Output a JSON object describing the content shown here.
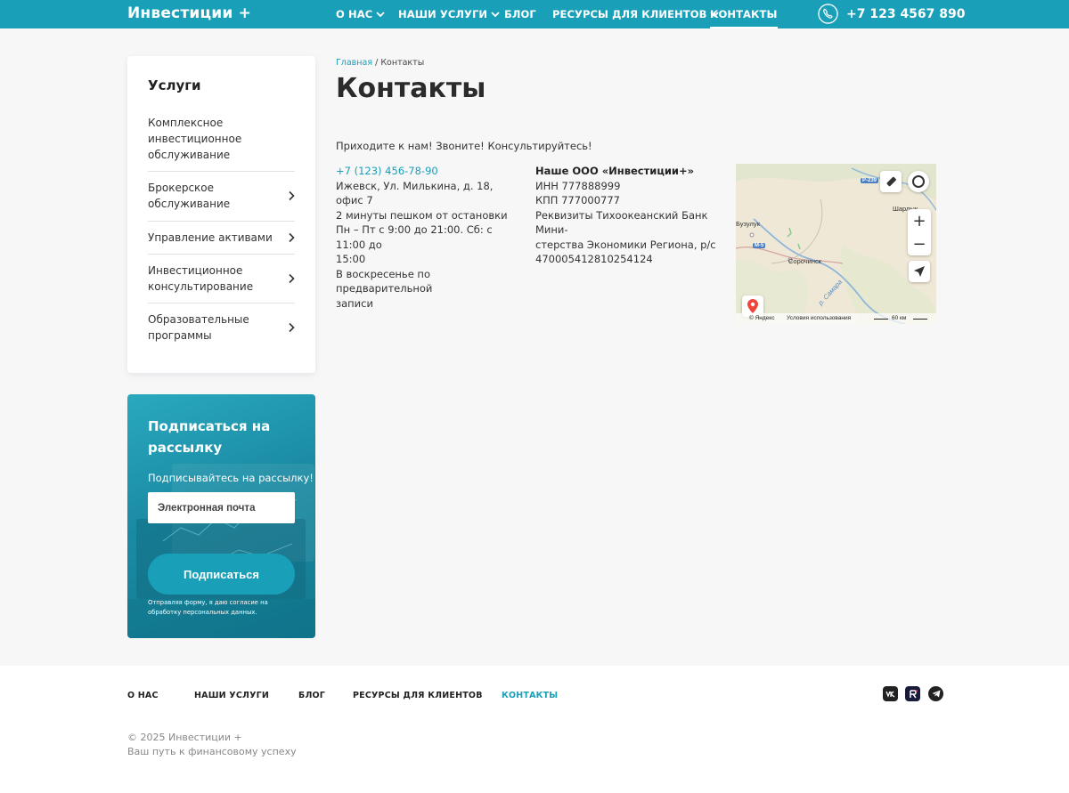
{
  "header": {
    "logo": "Инвестиции +",
    "nav": [
      {
        "label": "О НАС",
        "dropdown": true
      },
      {
        "label": "НАШИ УСЛУГИ",
        "dropdown": true
      },
      {
        "label": "БЛОГ",
        "dropdown": false
      },
      {
        "label": "РЕСУРСЫ ДЛЯ КЛИЕНТОВ",
        "dropdown": true
      },
      {
        "label": "КОНТАКТЫ",
        "dropdown": false,
        "active": true
      }
    ],
    "phone": "+7 123 4567 890",
    "phone_icon": "phone-icon"
  },
  "sidebar": {
    "title": "Услуги",
    "items": [
      {
        "line1": "Комплексное",
        "line2": "инвестиционное",
        "line3": "обслуживание",
        "arrow": false
      },
      {
        "line1": "Брокерское",
        "line2": "обслуживание",
        "arrow": true
      },
      {
        "line1": "Управление активами",
        "arrow": true
      },
      {
        "line1": "Инвестиционное",
        "line2": "консультирование",
        "arrow": true
      },
      {
        "line1": "Образовательные",
        "line2": "программы",
        "arrow": true
      }
    ]
  },
  "subscribe": {
    "title_line1": "Подписаться на",
    "title_line2": "рассылку",
    "text": "Подписывайтесь на рассылку!",
    "email_placeholder": "Электронная почта",
    "button": "Подписаться",
    "note_line1": "Отправляя форму, я даю согласие на",
    "note_line2": "обработку персональных данных."
  },
  "breadcrumb": {
    "home": "Главная",
    "separator": "/",
    "current": "Контакты"
  },
  "page_title": "Контакты",
  "lead": "Приходите к нам! Звоните! Консультируйтесь!",
  "contacts": {
    "phone": "+7 (123) 456-78-90",
    "address": "Ижевск, Ул. Милькина, д. 18, офис 7",
    "walk": "2 минуты пешком от остановки",
    "hours_line1": "Пн – Пт с 9:00 до 21:00. Сб: с 11:00 до",
    "hours_line2": "15:00",
    "sunday_line1": "В воскресенье по предварительной",
    "sunday_line2": "записи"
  },
  "company": {
    "name": "Наше ООО «Инвестиции+»",
    "inn": "ИНН 777888999",
    "kpp": "КПП 777000777",
    "req_line1": "Реквизиты Тихоокеанский Банк Мини-",
    "req_line2": "стерства Экономики Региона, р/с",
    "req_line3": "470005412810254124"
  },
  "map": {
    "cities": [
      "Бузулук",
      "Сорочинск",
      "Шарлык"
    ],
    "roads": [
      "Р-239",
      "М-5"
    ],
    "river": "р. Самара",
    "provider": "© Яндекс",
    "terms": "Условия использования",
    "scale": "60 км",
    "zoom_in": "+",
    "zoom_out": "−"
  },
  "footer": {
    "nav": [
      "О НАС",
      "НАШИ УСЛУГИ",
      "БЛОГ",
      "РЕСУРСЫ ДЛЯ КЛИЕНТОВ",
      "КОНТАКТЫ"
    ],
    "active": "КОНТАКТЫ",
    "social": [
      "vk-icon",
      "rutube-icon",
      "telegram-icon"
    ],
    "copyright": "© 2025 Инвестиции +",
    "tagline": "Ваш путь к финансовому успеху"
  },
  "colors": {
    "accent": "#1a9fb8",
    "background": "#f7f7f8",
    "text": "#2b2b2b"
  }
}
